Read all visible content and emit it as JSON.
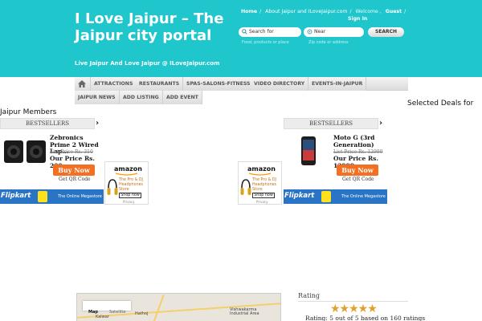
{
  "header": {
    "title": "I Love Jaipur – The Jaipur city portal",
    "tagline": "Live Jaipur And Love Jaipur @ ILoveJaipur.com",
    "top_links": [
      "Home",
      "About Jaipur and ILoveJaipur.com"
    ],
    "welcome_text": "Welcome ,",
    "guest_text": "Guest",
    "signin": "Sign In",
    "search": {
      "field1_value": "Search for",
      "field2_value": "Near",
      "hint1": "Food, products or place",
      "hint2": "Zip code or address",
      "button": "SEARCH"
    },
    "colors": {
      "header_bg": "#1fc6cc",
      "buy_button": "#f36f21",
      "flipkart": "#2a74c5"
    }
  },
  "nav": {
    "row1": [
      "ATTRACTIONS",
      "RESTAURANTS",
      "SPAS-SALONS-FITNESS",
      "VIDEO DIRECTORY",
      "EVENTS-IN-JAIPUR"
    ],
    "row2": [
      "JAIPUR NEWS",
      "ADD LISTING",
      "ADD EVENT"
    ],
    "home_icon": "home-icon"
  },
  "main": {
    "members_heading": "Jaipur Members",
    "deals_heading": "Selected Deals for"
  },
  "widgets": [
    {
      "header": "BESTSELLERS",
      "product_name": "Zebronics Prime 2 Wired Lap...",
      "list_price": "List Price Rs. 310",
      "our_price": "Our Price Rs. 200",
      "buy": "Buy Now",
      "qr": "Get QR Code",
      "flipkart_logo": "Flipkart",
      "flipkart_tag": "The Online Megastore"
    },
    {
      "header": "BESTSELLERS",
      "product_name": "Moto G (3rd Generation)",
      "list_price": "List Price Rs. 12999",
      "our_price": "Our Price Rs. 12999",
      "buy": "Buy Now",
      "qr": "Get QR Code",
      "flipkart_logo": "Flipkart",
      "flipkart_tag": "The Online Megastore"
    }
  ],
  "amazon_ad": {
    "logo": "amazon",
    "text": "The Pro & DJ Headphones Store",
    "shop": "Shop now",
    "privacy": "Privacy"
  },
  "map": {
    "tabs": [
      "Map",
      "Satellite"
    ],
    "labels": [
      "Hathoj",
      "Kalwar",
      "Vishwakarma Industrial Area"
    ]
  },
  "rating": {
    "title": "Rating",
    "stars": "★★★★★",
    "text": "Rating: 5 out of 5 based on 160 ratings"
  }
}
